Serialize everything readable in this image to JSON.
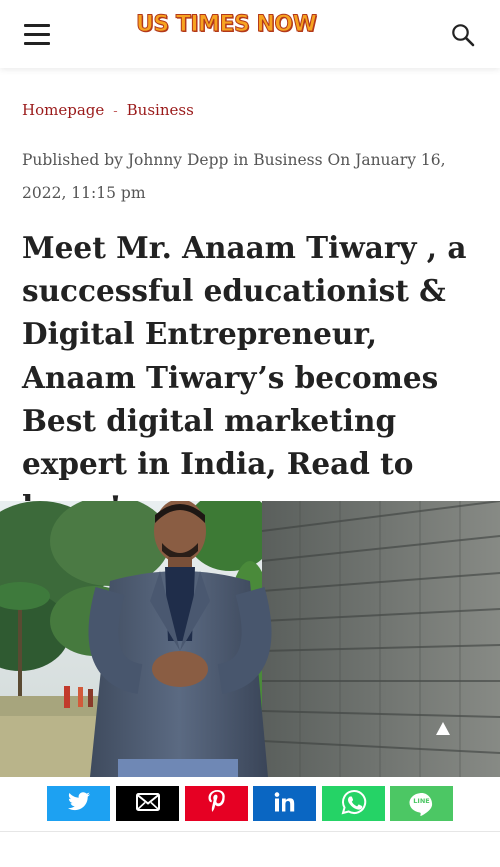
{
  "header": {
    "logo_text": "US TIMES NOW",
    "menu_icon": "hamburger-menu-icon",
    "search_icon": "search-icon"
  },
  "breadcrumb": {
    "home_label": "Homepage",
    "separator": "-",
    "category_label": "Business"
  },
  "article": {
    "meta": "Published by Johnny Depp in Business On January 16, 2022, 11:15 pm",
    "title": "Meet Mr. Anaam Tiwary , a successful educationist & Digital Entrepreneur, Anaam Tiwary’s becomes Best digital marketing expert in India, Read to know!"
  },
  "share_bar": {
    "buttons": [
      {
        "name": "twitter",
        "icon": "twitter-icon",
        "color": "#1da1f2"
      },
      {
        "name": "email",
        "icon": "email-icon",
        "color": "#000000"
      },
      {
        "name": "pinterest",
        "icon": "pinterest-icon",
        "color": "#e60023"
      },
      {
        "name": "linkedin",
        "icon": "linkedin-icon",
        "color": "#0a66c2"
      },
      {
        "name": "whatsapp",
        "icon": "whatsapp-icon",
        "color": "#25d366"
      },
      {
        "name": "line",
        "icon": "line-icon",
        "color": "#4cc764",
        "label": "LINE"
      }
    ]
  },
  "scroll_top_icon": "arrow-up-icon"
}
